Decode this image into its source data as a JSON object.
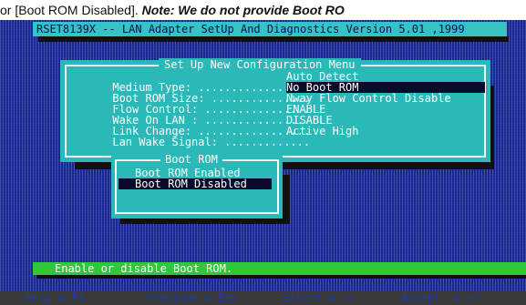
{
  "caption": {
    "prefix": "or [Boot ROM Disabled].",
    "note": " Note: We do not provide Boot RO"
  },
  "title_bar": "RSET8139X -- LAN Adapter SetUp And Diagnostics Version 5.01 ,1999",
  "menu": {
    "title": "Set Up New Configuration Menu",
    "rows": [
      {
        "label": "Medium Type: .................",
        "value": "Auto Detect"
      },
      {
        "label": "Boot ROM Size: ...............",
        "value": "No Boot ROM"
      },
      {
        "label": "Flow Control: ................",
        "value": "Nway Flow Control Disable"
      },
      {
        "label": "Wake On LAN : ................",
        "value": "ENABLE"
      },
      {
        "label": "Link Change: .................",
        "value": "DISABLE"
      },
      {
        "label": "Lan Wake Signal: .............",
        "value": "Active High"
      }
    ]
  },
  "popup": {
    "title": "Boot ROM",
    "options": [
      {
        "label": "Boot ROM Enabled"
      },
      {
        "label": "Boot ROM Disabled"
      }
    ]
  },
  "status_bar": "Enable or disable Boot ROM.",
  "help": [
    {
      "label": "Help = F1"
    },
    {
      "label": "Previous = Esc"
    },
    {
      "label": "Select = ↑↓"
    },
    {
      "label": "Accept  = ←┘"
    }
  ],
  "colors": {
    "screen_bg": "#1a2a9a",
    "menu_bg": "#2bb8b8",
    "status_bg": "#2ec83a",
    "selection_bg": "#0a0a2a"
  }
}
